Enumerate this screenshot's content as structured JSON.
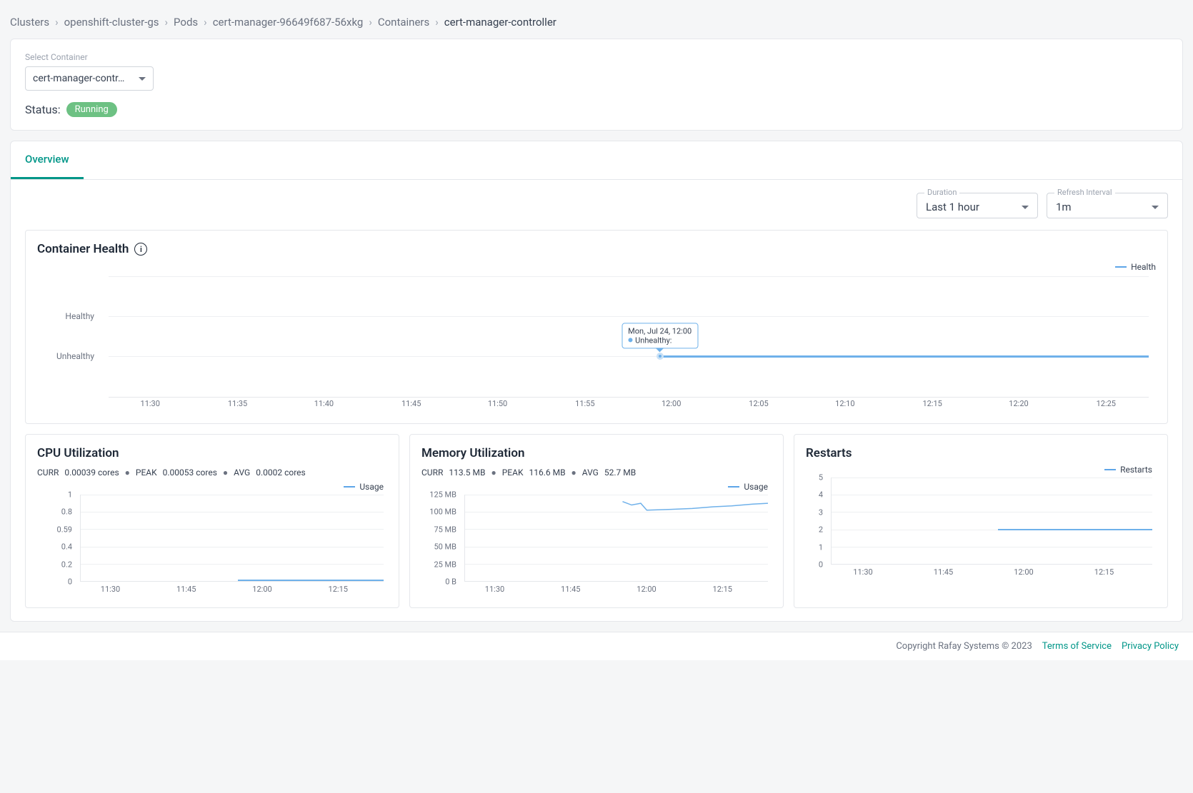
{
  "breadcrumb": {
    "items": [
      "Clusters",
      "openshift-cluster-gs",
      "Pods",
      "cert-manager-96649f687-56xkg",
      "Containers"
    ],
    "current": "cert-manager-controller"
  },
  "containerSelect": {
    "label": "Select Container",
    "value": "cert-manager-contr…"
  },
  "status": {
    "label": "Status:",
    "value": "Running"
  },
  "tabs": {
    "overview": "Overview"
  },
  "filters": {
    "duration": {
      "label": "Duration",
      "value": "Last 1 hour"
    },
    "refresh": {
      "label": "Refresh Interval",
      "value": "1m"
    }
  },
  "health": {
    "title": "Container Health",
    "legend": "Health",
    "ylabels": [
      "Healthy",
      "Unhealthy"
    ],
    "tooltip": {
      "time": "Mon, Jul 24, 12:00",
      "state": "Unhealthy:"
    }
  },
  "cpu": {
    "title": "CPU Utilization",
    "stats": {
      "curr_label": "CURR",
      "curr": "0.00039 cores",
      "peak_label": "PEAK",
      "peak": "0.00053 cores",
      "avg_label": "AVG",
      "avg": "0.0002 cores"
    },
    "legend": "Usage",
    "ylabels": [
      "1",
      "0.8",
      "0.59",
      "0.4",
      "0.2",
      "0"
    ]
  },
  "mem": {
    "title": "Memory Utilization",
    "stats": {
      "curr_label": "CURR",
      "curr": "113.5 MB",
      "peak_label": "PEAK",
      "peak": "116.6 MB",
      "avg_label": "AVG",
      "avg": "52.7 MB"
    },
    "legend": "Usage",
    "ylabels": [
      "125 MB",
      "100 MB",
      "75 MB",
      "50 MB",
      "25 MB",
      "0 B"
    ]
  },
  "restarts": {
    "title": "Restarts",
    "legend": "Restarts",
    "ylabels": [
      "5",
      "4",
      "3",
      "2",
      "1",
      "0"
    ]
  },
  "xticks_large": [
    "11:30",
    "11:35",
    "11:40",
    "11:45",
    "11:50",
    "11:55",
    "12:00",
    "12:05",
    "12:10",
    "12:15",
    "12:20",
    "12:25"
  ],
  "xticks_small": [
    "11:30",
    "11:45",
    "12:00",
    "12:15"
  ],
  "footer": {
    "copyright": "Copyright Rafay Systems © 2023",
    "tos": "Terms of Service",
    "privacy": "Privacy Policy"
  },
  "chart_data": [
    {
      "type": "line",
      "title": "Container Health",
      "x": [
        "11:30",
        "11:35",
        "11:40",
        "11:45",
        "11:50",
        "11:55",
        "12:00",
        "12:05",
        "12:10",
        "12:15",
        "12:20",
        "12:25"
      ],
      "series": [
        {
          "name": "Health",
          "values": [
            null,
            null,
            null,
            null,
            null,
            null,
            "Unhealthy",
            "Unhealthy",
            "Unhealthy",
            "Unhealthy",
            "Unhealthy",
            "Unhealthy"
          ]
        }
      ],
      "ycategories": [
        "Healthy",
        "Unhealthy"
      ],
      "tooltip": {
        "x": "12:00",
        "label": "Mon, Jul 24, 12:00",
        "value": "Unhealthy"
      }
    },
    {
      "type": "line",
      "title": "CPU Utilization",
      "ylabel": "cores",
      "ylim": [
        0,
        1
      ],
      "x": [
        "11:30",
        "11:45",
        "12:00",
        "12:15"
      ],
      "series": [
        {
          "name": "Usage",
          "values": [
            null,
            null,
            0.0004,
            0.0004
          ]
        }
      ],
      "summary": {
        "curr": 0.00039,
        "peak": 0.00053,
        "avg": 0.0002
      }
    },
    {
      "type": "line",
      "title": "Memory Utilization",
      "ylabel": "MB",
      "ylim": [
        0,
        125
      ],
      "x": [
        "11:30",
        "11:45",
        "12:00",
        "12:15"
      ],
      "series": [
        {
          "name": "Usage",
          "values": [
            null,
            null,
            113,
            113
          ]
        }
      ],
      "summary": {
        "curr": 113.5,
        "peak": 116.6,
        "avg": 52.7
      }
    },
    {
      "type": "line",
      "title": "Restarts",
      "ylabel": "",
      "ylim": [
        0,
        5
      ],
      "x": [
        "11:30",
        "11:45",
        "12:00",
        "12:15"
      ],
      "series": [
        {
          "name": "Restarts",
          "values": [
            null,
            null,
            2,
            2
          ]
        }
      ],
      "summary": {}
    }
  ]
}
